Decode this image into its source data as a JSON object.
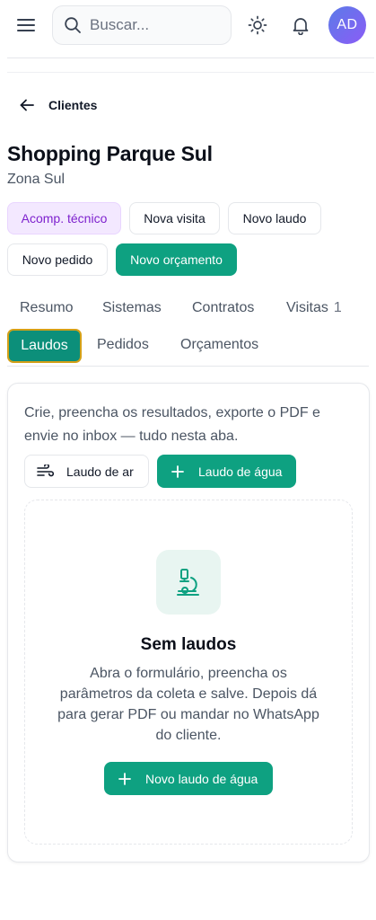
{
  "header": {
    "search_placeholder": "Buscar...",
    "avatar_initials": "AD"
  },
  "breadcrumb": {
    "back_label": "Clientes"
  },
  "client": {
    "name": "Shopping Parque Sul",
    "zone": "Zona Sul"
  },
  "actions": {
    "tag_label": "Acomp. técnico",
    "new_visit": "Nova visita",
    "new_report": "Novo laudo",
    "new_order": "Novo pedido",
    "new_quote": "Novo orçamento"
  },
  "tabs": {
    "resumo": "Resumo",
    "sistemas": "Sistemas",
    "contratos": "Contratos",
    "visitas": "Visitas",
    "visitas_count": "1",
    "laudos": "Laudos",
    "pedidos": "Pedidos",
    "orcamentos": "Orçamentos"
  },
  "laudos_panel": {
    "intro": "Crie, preencha os resultados, exporte o PDF e envie no inbox — tudo nesta aba.",
    "air_button": "Laudo de ar",
    "water_button": "Laudo de água",
    "empty_title": "Sem laudos",
    "empty_description": "Abra o formulário, preencha os parâmetros da coleta e salve. Depois dá para gerar PDF ou mandar no WhatsApp do cliente.",
    "empty_cta": "Novo laudo de água"
  },
  "colors": {
    "primary": "#0ea181",
    "active_tab_bg": "#0c8f7a",
    "active_tab_border": "#d4a017",
    "tag_bg": "#f3e8ff",
    "tag_text": "#7e22ce"
  }
}
